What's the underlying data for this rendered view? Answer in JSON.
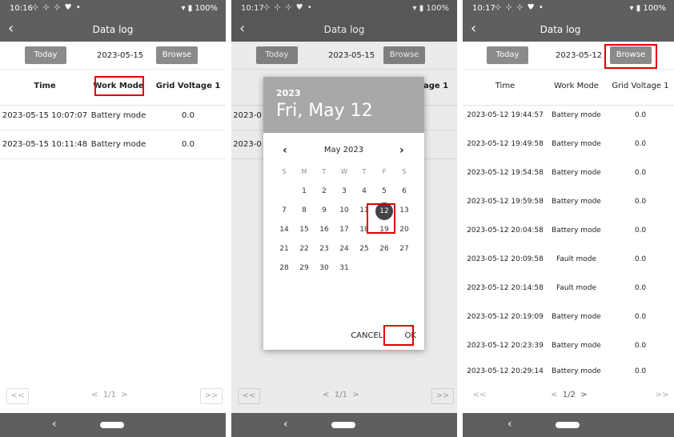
{
  "panel1": {
    "status_time": "10:16",
    "battery": "100%",
    "title": "Data log",
    "today_label": "Today",
    "date_text": "2023-05-15",
    "browse_label": "Browse",
    "headers": [
      "Time",
      "Work Mode",
      "Grid Voltage 1"
    ],
    "rows": [
      {
        "time": "2023-05-15 10:07:07",
        "mode": "Battery mode",
        "voltage": "0.0"
      },
      {
        "time": "2023-05-15 10:11:48",
        "mode": "Battery mode",
        "voltage": "0.0"
      }
    ],
    "pager": {
      "first": "<<",
      "prev": "<",
      "page": "1/1",
      "next": ">",
      "last": ">>"
    }
  },
  "panel2": {
    "status_time": "10:17",
    "battery": "100%",
    "title": "Data log",
    "today_label": "Today",
    "date_text": "2023-05-15",
    "browse_label": "Browse",
    "partial_header": "age 1",
    "partial_rows": [
      "2023-0",
      "2023-0"
    ],
    "dialog": {
      "year": "2023",
      "date_big": "Fri, May 12",
      "month_title": "May 2023",
      "prev_icon": "‹",
      "next_icon": "›",
      "weekdays": [
        "S",
        "M",
        "T",
        "W",
        "T",
        "F",
        "S"
      ],
      "weeks": [
        [
          "",
          "1",
          "2",
          "3",
          "4",
          "5",
          "6"
        ],
        [
          "7",
          "8",
          "9",
          "10",
          "11",
          "12",
          "13"
        ],
        [
          "14",
          "15",
          "16",
          "17",
          "18",
          "19",
          "20"
        ],
        [
          "21",
          "22",
          "23",
          "24",
          "25",
          "26",
          "27"
        ],
        [
          "28",
          "29",
          "30",
          "31",
          "",
          "",
          ""
        ]
      ],
      "selected_day": "12",
      "cancel_label": "CANCEL",
      "ok_label": "OK"
    },
    "pager": {
      "first": "<<",
      "prev": "<",
      "page": "1/1",
      "next": ">",
      "last": ">>"
    }
  },
  "panel3": {
    "status_time": "10:17",
    "battery": "100%",
    "title": "Data log",
    "today_label": "Today",
    "date_text": "2023-05-12",
    "browse_label": "Browse",
    "headers": [
      "Time",
      "Work Mode",
      "Grid Voltage 1"
    ],
    "rows": [
      {
        "time": "2023-05-12 19:44:57",
        "mode": "Battery mode",
        "voltage": "0.0"
      },
      {
        "time": "2023-05-12 19:49:58",
        "mode": "Battery mode",
        "voltage": "0.0"
      },
      {
        "time": "2023-05-12 19:54:58",
        "mode": "Battery mode",
        "voltage": "0.0"
      },
      {
        "time": "2023-05-12 19:59:58",
        "mode": "Battery mode",
        "voltage": "0.0"
      },
      {
        "time": "2023-05-12 20:04:58",
        "mode": "Battery mode",
        "voltage": "0.0"
      },
      {
        "time": "2023-05-12 20:09:58",
        "mode": "Fault mode",
        "voltage": "0.0"
      },
      {
        "time": "2023-05-12 20:14:58",
        "mode": "Fault mode",
        "voltage": "0.0"
      },
      {
        "time": "2023-05-12 20:19:09",
        "mode": "Battery mode",
        "voltage": "0.0"
      },
      {
        "time": "2023-05-12 20:23:39",
        "mode": "Battery mode",
        "voltage": "0.0"
      },
      {
        "time": "2023-05-12 20:29:14",
        "mode": "Battery mode",
        "voltage": "0.0"
      }
    ],
    "pager": {
      "first": "<<",
      "prev": "<",
      "page": "1/2",
      "next": ">",
      "last": ">>"
    }
  },
  "icons": {
    "back": "‹",
    "nav_back": "‹",
    "status_misc": "⊹ ⊹ ⊹ ♥ •",
    "wifi_battery": "▾ ▮"
  },
  "colors": {
    "bar": "#5f5f5f",
    "button": "#8a8a8a",
    "highlight": "#e00000",
    "selected_day": "#444444"
  }
}
